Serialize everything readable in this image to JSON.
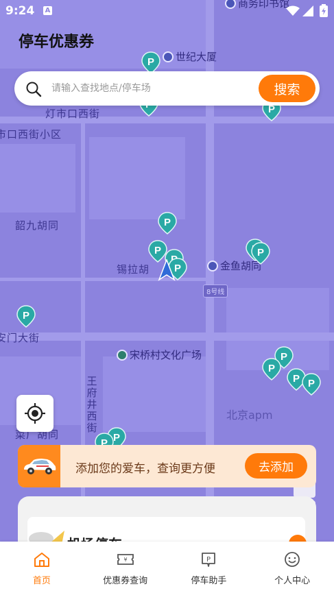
{
  "status_bar": {
    "time": "9:24",
    "notif_icon": "A"
  },
  "header": {
    "title": "停车优惠券"
  },
  "search": {
    "placeholder": "请输入查找地点/停车场",
    "button_label": "搜索"
  },
  "map": {
    "streets": [
      "灯市口西街",
      "市口西街小区",
      "韶九胡同",
      "锡拉胡",
      "安门大街",
      "王府井西街",
      "菜厂胡同"
    ],
    "pois": [
      "世纪大厦",
      "金鱼胡同",
      "宋桥村文化广场",
      "北京apm",
      "商务印书馆"
    ],
    "metro_badge": "8号线",
    "pin_label": "P"
  },
  "add_car": {
    "text": "添加您的爱车，查询更方便",
    "button_label": "去添加"
  },
  "sheet": {
    "card_title": "机场停车"
  },
  "bottom_nav": {
    "items": [
      {
        "label": "首页",
        "icon": "home-icon",
        "active": true
      },
      {
        "label": "优惠券查询",
        "icon": "coupon-icon",
        "active": false
      },
      {
        "label": "停车助手",
        "icon": "parking-icon",
        "active": false
      },
      {
        "label": "个人中心",
        "icon": "smile-icon",
        "active": false
      }
    ]
  },
  "colors": {
    "accent": "#ff7a0a",
    "map": "#8c83de",
    "pin": "#2aa9a5"
  }
}
